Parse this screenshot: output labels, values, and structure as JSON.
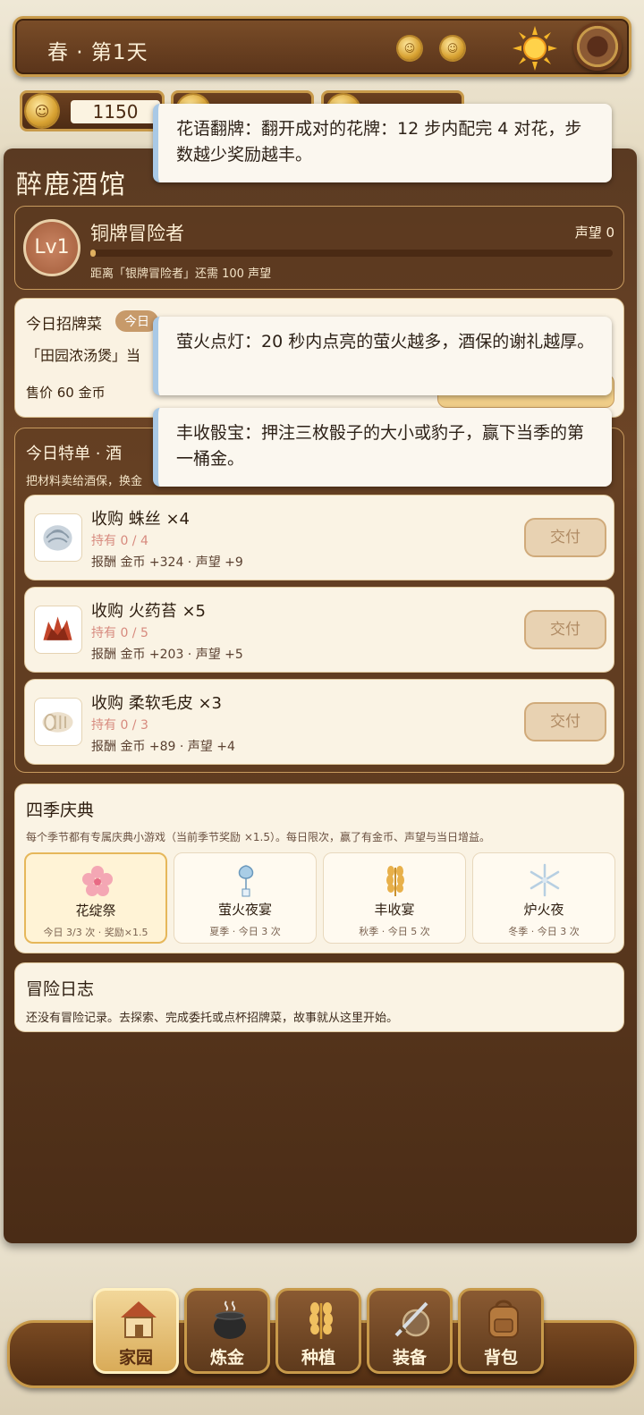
{
  "topbar": {
    "season_day": "春 · 第1天"
  },
  "resources": {
    "gold": "1150"
  },
  "tavern": {
    "name": "醉鹿酒馆"
  },
  "rank": {
    "level": "Lv1",
    "title": "铜牌冒险者",
    "reputation": "声望 0",
    "progress": 0,
    "note": "距离「银牌冒险者」还需 100 声望"
  },
  "special": {
    "title": "今日招牌菜",
    "badge": "今日",
    "dish": "「田园浓汤煲」当",
    "price": "售价 60 金币"
  },
  "orders": {
    "title": "今日特单 · 酒",
    "subtitle": "把材料卖给酒保，换金",
    "items": [
      {
        "name": "收购 蛛丝 ×4",
        "hold": "持有 0 / 4",
        "reward": "报酬 金币 +324 · 声望 +9",
        "button": "交付",
        "icon": "spider-silk-icon"
      },
      {
        "name": "收购 火药苔 ×5",
        "hold": "持有 0 / 5",
        "reward": "报酬 金币 +203 · 声望 +5",
        "button": "交付",
        "icon": "gunpowder-moss-icon"
      },
      {
        "name": "收购 柔软毛皮 ×3",
        "hold": "持有 0 / 3",
        "reward": "报酬 金币 +89 · 声望 +4",
        "button": "交付",
        "icon": "soft-fur-icon"
      }
    ]
  },
  "festivals": {
    "title": "四季庆典",
    "subtitle": "每个季节都有专属庆典小游戏（当前季节奖励 ×1.5）。每日限次，赢了有金币、声望与当日增益。",
    "items": [
      {
        "name": "花绽祭",
        "info": "今日 3/3 次 · 奖励×1.5",
        "icon": "sakura-icon"
      },
      {
        "name": "萤火夜宴",
        "info": "夏季 · 今日 3 次",
        "icon": "wind-chime-icon"
      },
      {
        "name": "丰收宴",
        "info": "秋季 · 今日 5 次",
        "icon": "wheat-icon"
      },
      {
        "name": "炉火夜",
        "info": "冬季 · 今日 3 次",
        "icon": "snowflake-icon"
      }
    ]
  },
  "log": {
    "title": "冒险日志",
    "text": "还没有冒险记录。去探索、完成委托或点杯招牌菜，故事就从这里开始。"
  },
  "tooltips": [
    "花语翻牌：翻开成对的花牌：12 步内配完 4 对花，步数越少奖励越丰。",
    "萤火点灯：20 秒内点亮的萤火越多，酒保的谢礼越厚。",
    "丰收骰宝：押注三枚骰子的大小或豹子，赢下当季的第一桶金。"
  ],
  "nav": [
    {
      "label": "家园",
      "icon": "house-icon",
      "active": true
    },
    {
      "label": "炼金",
      "icon": "cauldron-icon"
    },
    {
      "label": "种植",
      "icon": "wheat-icon"
    },
    {
      "label": "装备",
      "icon": "sword-shield-icon"
    },
    {
      "label": "背包",
      "icon": "backpack-icon"
    }
  ],
  "colors": {
    "accent_gold": "#c89a4a",
    "panel_brown": "#5e3b20",
    "tooltip_border": "#a9c9e6"
  }
}
